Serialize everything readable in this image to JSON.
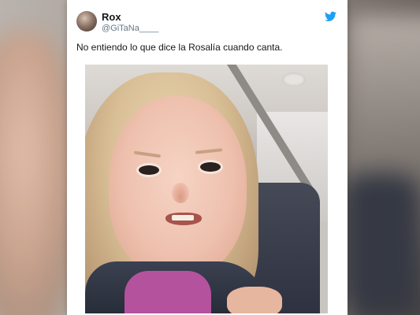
{
  "tweet": {
    "display_name": "Rox",
    "handle": "@GiTaNa____",
    "text": "No entiendo lo que dice la Rosalía cuando canta.",
    "brand_icon": "twitter-bird-icon",
    "brand_color": "#1da1f2"
  }
}
